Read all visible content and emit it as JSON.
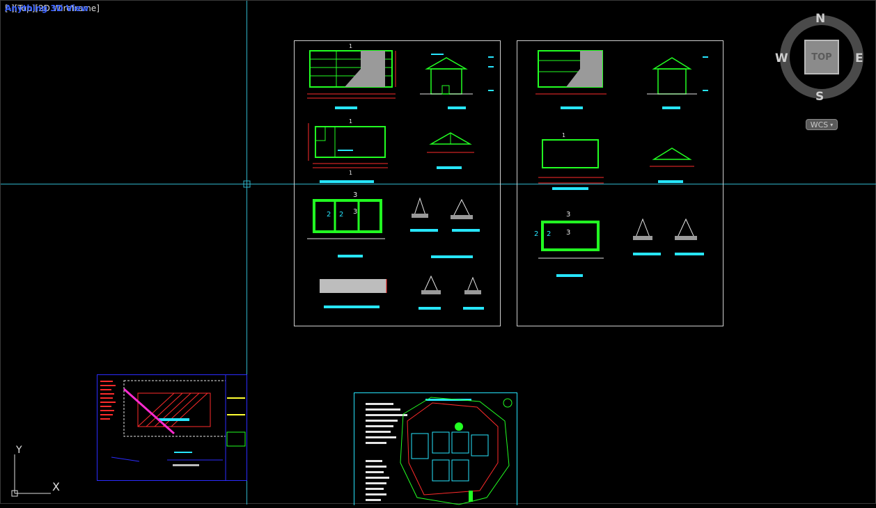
{
  "viewport": {
    "label": "[-][Top][2D Wireframe]",
    "label_overlay": "Anything 3D View",
    "background": "#000000",
    "crosshair_color": "#2fb3c8"
  },
  "viewcube": {
    "face": "TOP",
    "north": "N",
    "south": "S",
    "east": "E",
    "west": "W",
    "wcs": "WCS",
    "wcs_arrow": "chevron-down-icon"
  },
  "ucs": {
    "x_label": "X",
    "y_label": "Y"
  },
  "drawing_labels": {
    "number_1": "1",
    "number_2": "2",
    "number_3": "3"
  },
  "colors": {
    "green": "#22ff22",
    "cyan": "#27e6ff",
    "red": "#ff2b2b",
    "white": "#e6e6e6",
    "blue_frame": "#2c2cff",
    "magenta": "#ff2bd0",
    "yellow": "#ffff33"
  }
}
